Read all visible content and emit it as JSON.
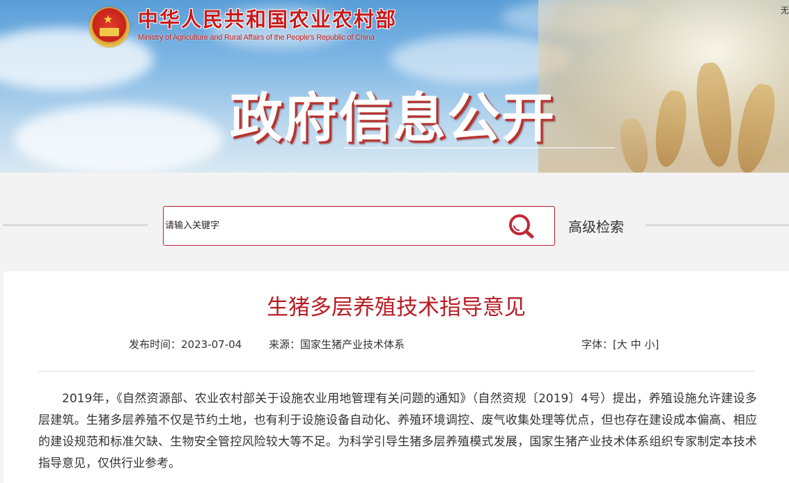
{
  "header": {
    "ministry_cn": "中华人民共和国农业农村部",
    "ministry_en": "Ministry of Agriculture and Rural Affairs of the People's Republic of China",
    "banner_title": "政府信息公开",
    "corner_text": "无",
    "emblem_icon": "national-emblem-icon",
    "brand_color": "#c81a1a"
  },
  "search": {
    "placeholder": "请输入关键字",
    "advanced_label": "高级检索",
    "icon": "search-icon",
    "border_color": "#b9202a"
  },
  "article": {
    "title": "生猪多层养殖技术指导意见",
    "publish_label": "发布时间：",
    "publish_date": "2023-07-04",
    "source_label": "来源：",
    "source": "国家生猪产业技术体系",
    "font_label": "字体：",
    "font_open": "[",
    "font_large": "大",
    "font_medium": "中",
    "font_small": "小",
    "font_close": "]",
    "paragraph": "2019年，《自然资源部、农业农村部关于设施农业用地管理有关问题的通知》（自然资规〔2019〕4号）提出，养殖设施允许建设多层建筑。生猪多层养殖不仅是节约土地，也有利于设施设备自动化、养殖环境调控、废气收集处理等优点，但也存在建设成本偏高、相应的建设规范和标准欠缺、生物安全管控风险较大等不足。为科学引导生猪多层养殖模式发展，国家生猪产业技术体系组织专家制定本技术指导意见，仅供行业参考。",
    "title_color": "#b81c24"
  }
}
